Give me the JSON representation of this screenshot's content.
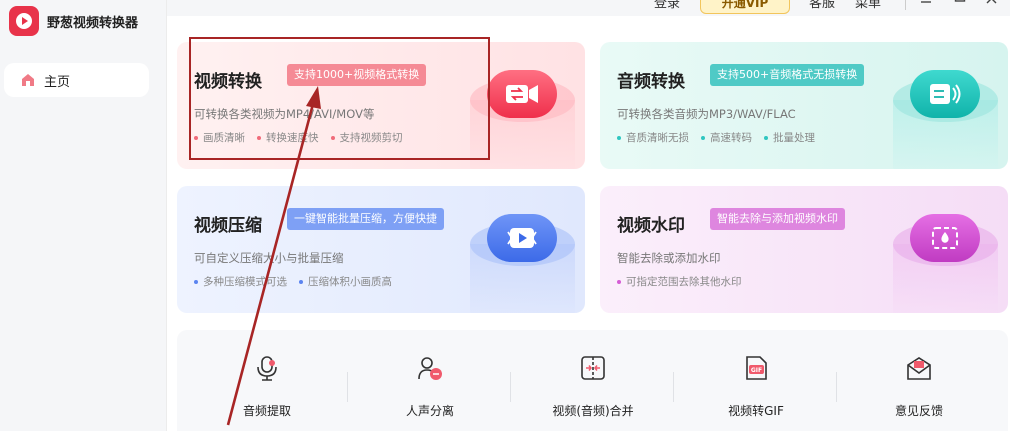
{
  "app": {
    "name": "野葱视频转换器"
  },
  "sidebar": {
    "items": [
      {
        "label": "主页",
        "active": true
      }
    ]
  },
  "topbar": {
    "login": "登录",
    "vip": "开通VIP",
    "service": "客服",
    "menu": "菜单"
  },
  "cards": [
    {
      "title": "视频转换",
      "tag": "支持1000+视频格式转换",
      "desc": "可转换各类视频为MP4/AVI/MOV等",
      "features": [
        "画质清晰",
        "转换速度快",
        "支持视频剪切"
      ],
      "accent": "#f06b7a"
    },
    {
      "title": "音频转换",
      "tag": "支持500+音频格式无损转换",
      "desc": "可转换各类音频为MP3/WAV/FLAC",
      "features": [
        "音质清晰无损",
        "高速转码",
        "批量处理"
      ],
      "accent": "#2fc6c0"
    },
    {
      "title": "视频压缩",
      "tag": "一键智能批量压缩，方便快捷",
      "desc": "可自定义压缩大小与批量压缩",
      "features": [
        "多种压缩模式可选",
        "压缩体积小画质高"
      ],
      "accent": "#5b84f0"
    },
    {
      "title": "视频水印",
      "tag": "智能去除与添加视频水印",
      "desc": "智能去除或添加水印",
      "features": [
        "可指定范围去除其他水印"
      ],
      "accent": "#d55cd5"
    }
  ],
  "tools": [
    {
      "label": "音频提取",
      "icon": "microphone-icon"
    },
    {
      "label": "人声分离",
      "icon": "voice-separation-icon"
    },
    {
      "label": "视频(音频)合并",
      "icon": "merge-icon"
    },
    {
      "label": "视频转GIF",
      "icon": "gif-icon"
    },
    {
      "label": "意见反馈",
      "icon": "feedback-mail-icon"
    }
  ],
  "colors": {
    "brand": "#e8334a",
    "annotation": "#a82525"
  }
}
